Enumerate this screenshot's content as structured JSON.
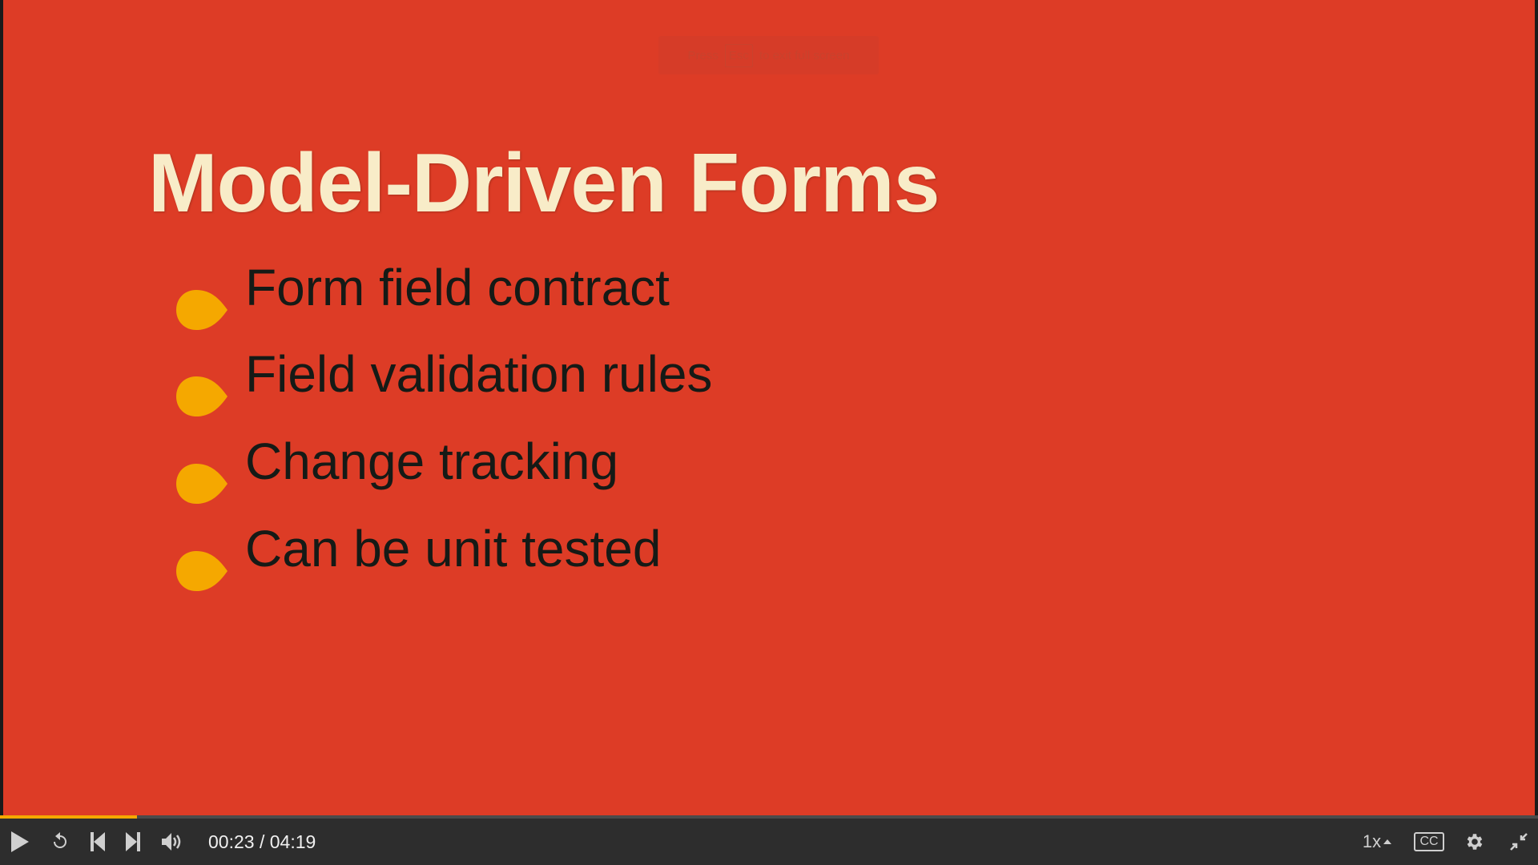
{
  "slide": {
    "title": "Model-Driven Forms",
    "bullets": [
      "Form field contract",
      "Field validation rules",
      "Change tracking",
      "Can be unit tested"
    ]
  },
  "fullscreen_hint": {
    "press": "Press",
    "key": "Esc",
    "rest": "to exit full screen"
  },
  "player": {
    "current_time": "00:23",
    "separator": " / ",
    "duration": "04:19",
    "progress_fraction": 0.089,
    "speed": "1x",
    "cc_label": "CC"
  },
  "colors": {
    "background": "#dd3c26",
    "bullet": "#f5a800",
    "title": "#f8ecc8",
    "progress": "#f5a800"
  },
  "icons": [
    "play-icon",
    "replay-icon",
    "skip-back-icon",
    "skip-forward-icon",
    "volume-icon",
    "captions-icon",
    "gear-icon",
    "exit-fullscreen-icon"
  ]
}
